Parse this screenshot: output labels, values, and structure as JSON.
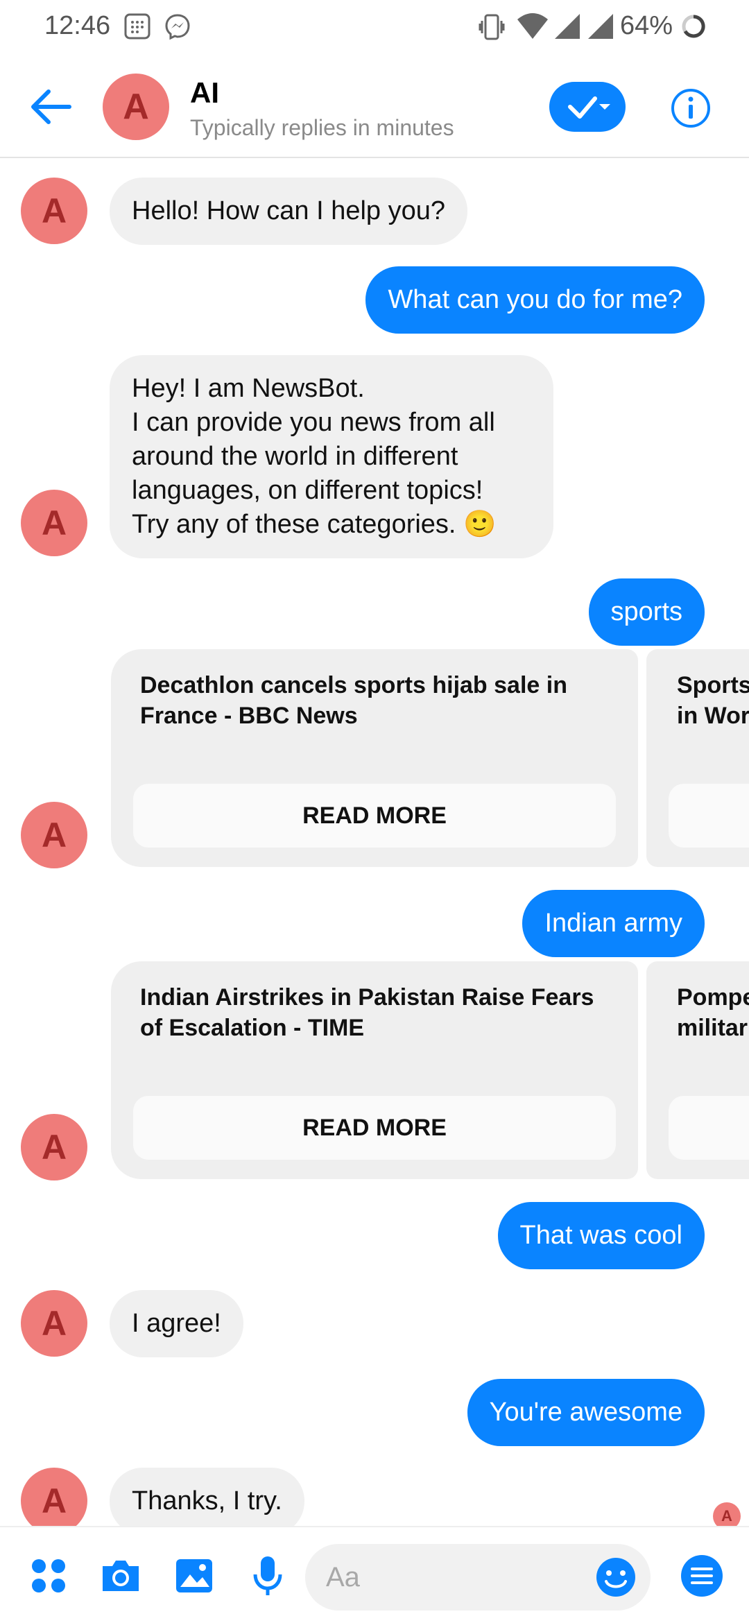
{
  "status_bar": {
    "time": "12:46",
    "battery": "64%"
  },
  "header": {
    "name": "AI",
    "subtitle": "Typically replies in minutes",
    "avatar_letter": "A"
  },
  "messages": [
    {
      "from": "bot",
      "text": "Hello! How can I help you?"
    },
    {
      "from": "user",
      "text": "What can you do for me?"
    },
    {
      "from": "bot",
      "lines": [
        "Hey! I am NewsBot.",
        "I can provide you news from all",
        "around the world in different",
        "languages, on different topics!",
        "Try any of these categories. 🙂"
      ]
    },
    {
      "from": "user",
      "text": "sports"
    },
    {
      "from": "bot_cards",
      "cards": [
        {
          "title": "Decathlon cancels sports hijab sale in France - BBC News",
          "button": "READ MORE"
        },
        {
          "title": "Sports ... in Wor...",
          "title_visible": [
            "Sports",
            "in Wor"
          ]
        }
      ]
    },
    {
      "from": "user",
      "text": "Indian army"
    },
    {
      "from": "bot_cards",
      "cards": [
        {
          "title": "Indian Airstrikes in Pakistan Raise Fears of Escalation - TIME",
          "button": "READ MORE"
        },
        {
          "title": "Pompe... militar...",
          "title_visible": [
            "Pompe",
            "militar"
          ]
        }
      ]
    },
    {
      "from": "user",
      "text": "That was cool"
    },
    {
      "from": "bot",
      "text": "I agree!"
    },
    {
      "from": "user",
      "text": "You're awesome"
    },
    {
      "from": "bot",
      "text": "Thanks, I try."
    }
  ],
  "composer": {
    "placeholder": "Aa"
  },
  "icons": {
    "back": "back-arrow-icon",
    "check": "check-dropdown-icon",
    "info": "info-icon",
    "apps": "apps-grid-icon",
    "camera": "camera-icon",
    "gallery": "gallery-icon",
    "mic": "microphone-icon",
    "emoji": "emoji-icon",
    "menu": "menu-icon"
  },
  "colors": {
    "accent": "#0a84ff",
    "avatar_bg": "#ef7c7a",
    "avatar_letter": "#a42a2a",
    "incoming_bubble": "#f0f0f0"
  }
}
